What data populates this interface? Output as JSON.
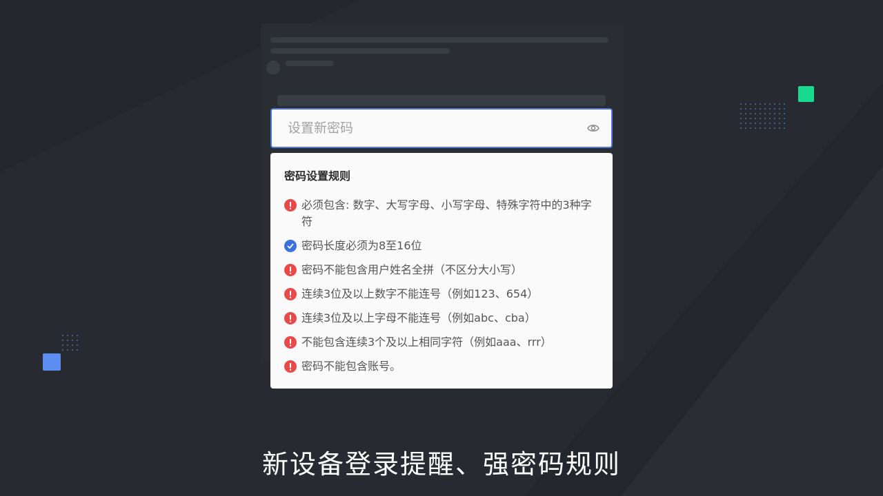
{
  "colors": {
    "background": "#23272c",
    "accent_blue": "#4f78e3",
    "error_red": "#e84a4a",
    "ok_blue": "#3c6fe0",
    "deco_green": "#18d98d",
    "deco_blue": "#5b8ef0"
  },
  "password_field": {
    "placeholder": "设置新密码",
    "value": "",
    "toggle_icon": "eye-icon"
  },
  "rules_panel": {
    "title": "密码设置规则",
    "rules": [
      {
        "status": "error",
        "icon": "exclamation-circle-icon",
        "text": "必须包含: 数字、大写字母、小写字母、特殊字符中的3种字符"
      },
      {
        "status": "ok",
        "icon": "check-circle-icon",
        "text": "密码长度必须为8至16位"
      },
      {
        "status": "error",
        "icon": "exclamation-circle-icon",
        "text": "密码不能包含用户姓名全拼（不区分大小写）"
      },
      {
        "status": "error",
        "icon": "exclamation-circle-icon",
        "text": "连续3位及以上数字不能连号（例如123、654）"
      },
      {
        "status": "error",
        "icon": "exclamation-circle-icon",
        "text": "连续3位及以上字母不能连号（例如abc、cba）"
      },
      {
        "status": "error",
        "icon": "exclamation-circle-icon",
        "text": "不能包含连续3个及以上相同字符（例如aaa、rrr）"
      },
      {
        "status": "error",
        "icon": "exclamation-circle-icon",
        "text": "密码不能包含账号。"
      }
    ]
  },
  "subtitle": "新设备登录提醒、强密码规则"
}
